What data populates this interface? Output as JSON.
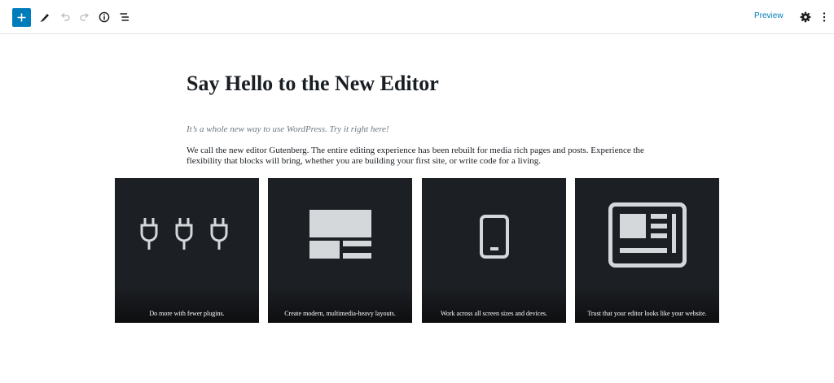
{
  "toolbar": {
    "icons": [
      "plus-icon",
      "pencil-icon",
      "undo-icon",
      "redo-icon",
      "info-icon",
      "list-view-icon",
      "gear-icon",
      "more-vertical-icon"
    ],
    "preview_label": "Preview",
    "accent": "#007cba"
  },
  "editor": {
    "title": "Say Hello to the New Editor",
    "intro": "It’s a whole new way to use WordPress. Try it right here!",
    "paragraph": "We call the new editor Gutenberg. The entire editing experience has been rebuilt for media rich pages and posts. Experience the flexibility that blocks will bring, whether you are building your first site, or write code for a living."
  },
  "gallery": {
    "items": [
      {
        "icon": "plugs-icon",
        "caption": "Do more with fewer plugins."
      },
      {
        "icon": "layout-icon",
        "caption": "Create modern, multimedia-heavy layouts."
      },
      {
        "icon": "mobile-icon",
        "caption": "Work across all screen sizes and devices."
      },
      {
        "icon": "newspaper-icon",
        "caption": "Trust that your editor looks like your website."
      }
    ],
    "card_color": "#1c1f23"
  }
}
